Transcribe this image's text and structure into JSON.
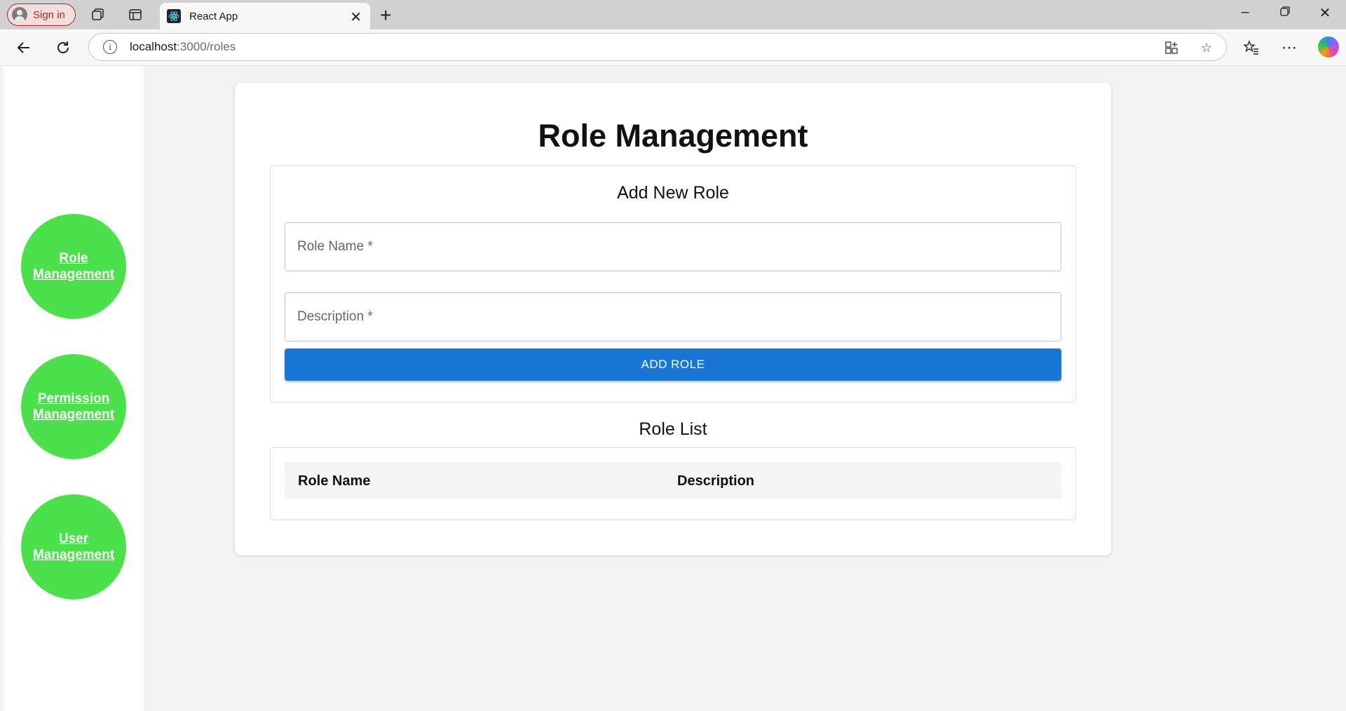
{
  "browser": {
    "signin_label": "Sign in",
    "tab_title": "React App",
    "url_host": "localhost",
    "url_path": ":3000/roles"
  },
  "sidebar": {
    "items": [
      {
        "label": "Role Management"
      },
      {
        "label": "Permission Management"
      },
      {
        "label": "User Management"
      }
    ]
  },
  "main": {
    "title": "Role Management",
    "form": {
      "title": "Add New Role",
      "role_name_placeholder": "Role Name *",
      "description_placeholder": "Description *",
      "submit_label": "ADD ROLE"
    },
    "list": {
      "title": "Role List",
      "columns": [
        "Role Name",
        "Description"
      ],
      "rows": []
    }
  },
  "colors": {
    "nav_circle": "#4ce04c",
    "primary_button": "#1976d2"
  }
}
